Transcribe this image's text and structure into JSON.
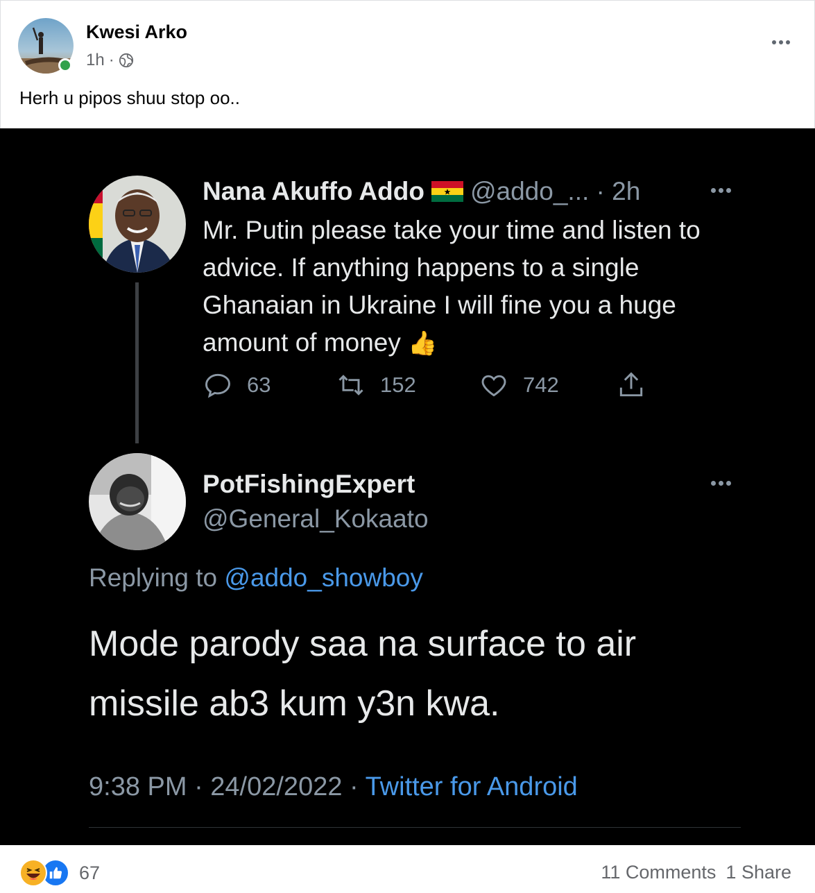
{
  "post": {
    "author": "Kwesi Arko",
    "time": "1h",
    "separator": "·",
    "caption": "Herh u pipos shuu stop oo.."
  },
  "tweet_original": {
    "name": "Nana Akuffo Addo",
    "handle_time": "@addo_... · 2h",
    "text": "Mr. Putin please take your time and listen to advice. If anything happens to a single Ghanaian in Ukraine I will fine you a huge amount of money",
    "emoji": "👍",
    "replies": "63",
    "retweets": "152",
    "likes": "742"
  },
  "tweet_reply": {
    "name": "PotFishingExpert",
    "handle": "@General_Kokaato",
    "replying_prefix": "Replying to",
    "replying_to": "@addo_showboy",
    "text": "Mode parody saa na surface to air missile ab3 kum y3n kwa.",
    "datetime": "9:38 PM · 24/02/2022 ·",
    "source": "Twitter for Android"
  },
  "footer": {
    "reaction_count": "67",
    "comments": "11 Comments",
    "shares": "1 Share"
  },
  "colors": {
    "online": "#31a24c",
    "twitter_link": "#4a99e9",
    "like_blue": "#1877f2",
    "haha_yellow": "#f7b125"
  }
}
